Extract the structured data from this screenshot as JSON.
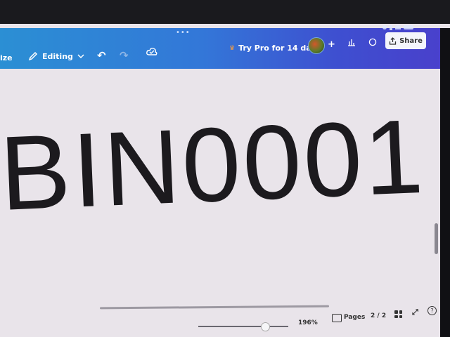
{
  "statusbar": {
    "dots": "•••"
  },
  "toolbar": {
    "resize_label": "ize",
    "editing_label": "Editing",
    "undo_icon": "↶",
    "redo_icon": "↷",
    "trypro_label": "Try Pro for 14 days",
    "plus_icon": "+",
    "share_label": "Share"
  },
  "canvas": {
    "text": "BIN0001"
  },
  "footer": {
    "zoom": "196%",
    "zoom_level": 0.7,
    "pages_label": "Pages",
    "page_count": "2 / 2",
    "help": "?"
  },
  "colors": {
    "toolbar_start": "#2b8fd4",
    "toolbar_end": "#4a3fcb",
    "canvas_bg": "#e9e4ea",
    "text": "#1c1a1e"
  }
}
